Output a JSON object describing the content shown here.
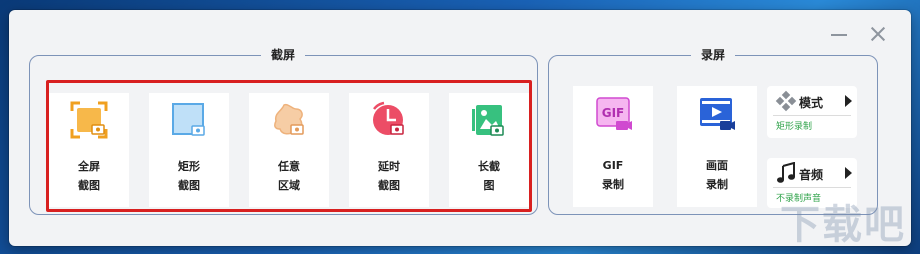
{
  "window": {
    "minimize_label": "—",
    "close_label": "✕"
  },
  "screenshot_group": {
    "title": "截屏",
    "tools": [
      {
        "line1": "全屏",
        "line2": "截图",
        "icon": "fullscreen-capture-icon",
        "color": "#f5a623"
      },
      {
        "line1": "矩形",
        "line2": "截图",
        "icon": "rectangle-capture-icon",
        "color": "#6fb7ea"
      },
      {
        "line1": "任意",
        "line2": "区域",
        "icon": "freeform-capture-icon",
        "color": "#f2c196"
      },
      {
        "line1": "延时",
        "line2": "截图",
        "icon": "delayed-capture-icon",
        "color": "#e8445f"
      },
      {
        "line1": "长截",
        "line2": "图",
        "icon": "scrolling-capture-icon",
        "color": "#2fb675"
      }
    ]
  },
  "record_group": {
    "title": "录屏",
    "tools": [
      {
        "line1": "GIF",
        "line2": "录制",
        "icon": "gif-record-icon",
        "color": "#d04ad0"
      },
      {
        "line1": "画面",
        "line2": "录制",
        "icon": "screen-record-icon",
        "color": "#2a63d8"
      }
    ],
    "mode": {
      "title": "模式",
      "value": "矩形录制",
      "icon": "mode-icon"
    },
    "audio": {
      "title": "音频",
      "value": "不录制声音",
      "icon": "music-note-icon"
    }
  },
  "watermark": "下载吧"
}
